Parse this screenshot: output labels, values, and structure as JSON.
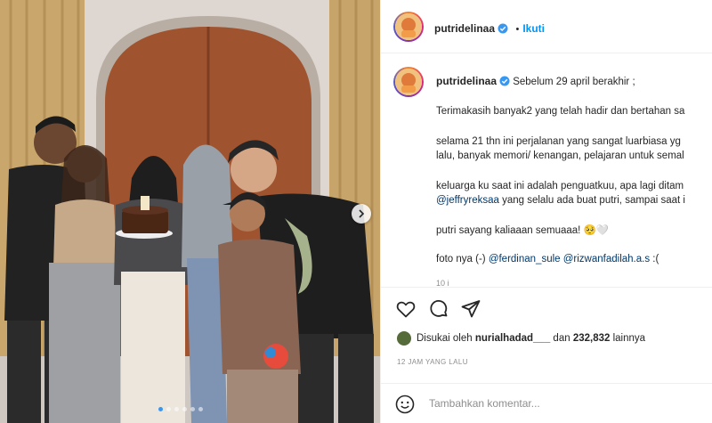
{
  "post": {
    "username": "putridelinaa",
    "follow_label": "Ikuti",
    "caption_first_line": "Sebelum 29 april berakhir ;",
    "caption_lines": [
      {
        "text": "Terimakasih banyak2 yang telah hadir dan bertahan sa"
      },
      {
        "text": "selama 21 thn ini perjalanan yang sangat luarbiasa yg"
      },
      {
        "text": "lalu, banyak memori/ kenangan, pelajaran untuk semal"
      },
      {
        "text": "keluarga ku saat ini adalah penguatkuu, apa lagi ditam"
      },
      {
        "mention": "@jeffryreksaa",
        "text": " yang selalu ada buat putri, sampai saat i"
      },
      {
        "text": "putri sayang kaliaaan semuaaa! 🥺🤍"
      },
      {
        "prefix": "foto nya (-) ",
        "mention1": "@ferdinan_sule",
        "mention2": "@rizwanfadilah.a.s",
        "suffix": " :("
      }
    ],
    "truncated_hint": "10 j"
  },
  "likes": {
    "prefix": "Disukai oleh ",
    "user": "nurialhadad___",
    "middle": " dan ",
    "count": "232,832",
    "suffix": " lainnya"
  },
  "timestamp": "12 JAM YANG LALU",
  "comment": {
    "placeholder": "Tambahkan komentar..."
  },
  "carousel": {
    "total_slides": 6,
    "active_index": 0
  },
  "colors": {
    "accent_blue": "#0095f6",
    "mention_blue": "#00376b",
    "text": "#262626",
    "muted": "#8e8e8e",
    "border": "#efefef"
  },
  "icons": [
    "verified-badge-icon",
    "heart-icon",
    "comment-icon",
    "share-icon",
    "emoji-icon",
    "chevron-right-icon"
  ]
}
